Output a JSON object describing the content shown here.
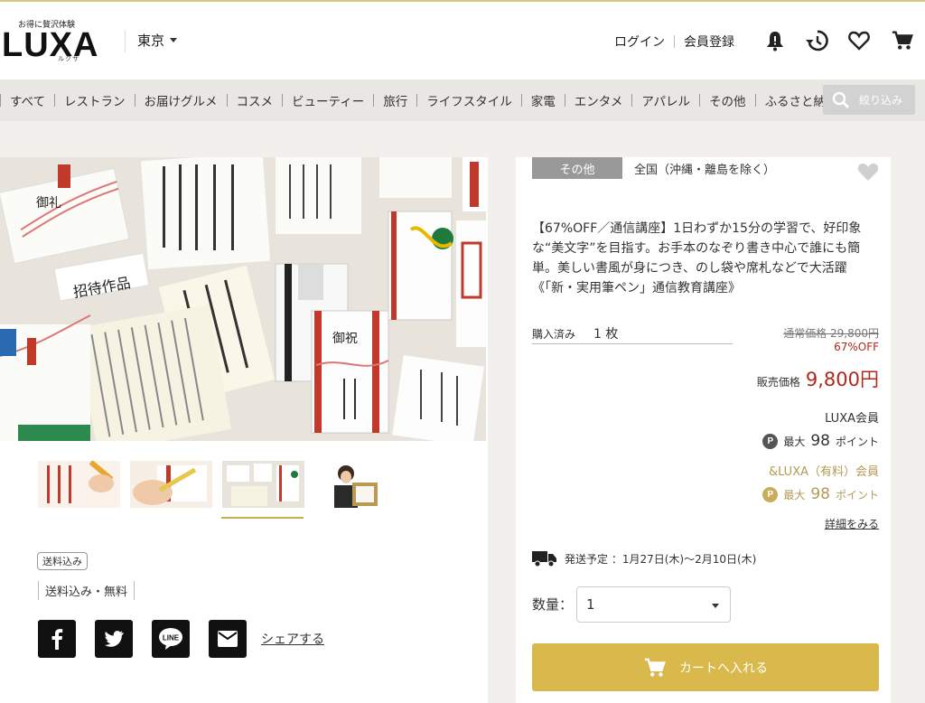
{
  "header": {
    "logo_tagline": "お得に贅沢体験",
    "logo_text": "LUXA",
    "logo_kana": "ルクサ",
    "region": "東京",
    "login": "ログイン",
    "register": "会員登録",
    "icons": [
      "bell-icon",
      "history-icon",
      "heart-icon",
      "cart-icon"
    ]
  },
  "categories": [
    "すべて",
    "レストラン",
    "お届けグルメ",
    "コスメ",
    "ビューティー",
    "旅行",
    "ライフスタイル",
    "家電",
    "エンタメ",
    "アパレル",
    "その他",
    "ふるさと納税"
  ],
  "search": {
    "label": "絞り込み"
  },
  "left": {
    "shipping_badge": "送料込み",
    "shipping_text": "送料込み・無料",
    "share": "シェアする",
    "social_icons": [
      "facebook-icon",
      "twitter-icon",
      "line-icon",
      "mail-icon"
    ],
    "image_texts": {
      "invite": "招待作品",
      "gyoshu": "御祝",
      "gorei": "御礼"
    }
  },
  "product": {
    "category": "その他",
    "area": "全国（沖縄・離島を除く）",
    "description": "【67%OFF／通信講座】1日わずか15分の学習で、好印象な“美文字”を目指す。お手本のなぞり書き中心で誰にも簡単。美しい書風が身につき、のし袋や席札などで大活躍《「新・実用筆ペン」通信教育講座》",
    "purchased_label": "購入済み",
    "purchased_value": "1 枚",
    "regular_price": "通常価格 29,800円",
    "discount": "67%OFF",
    "sale_label": "販売価格",
    "sale_price": "9,800円",
    "member_label": "LUXA会員",
    "member_points_prefix": "最大",
    "member_points": "98",
    "member_points_suffix": "ポイント",
    "premium_label": "&LUXA（有料）会員",
    "premium_points_prefix": "最大",
    "premium_points": "98",
    "premium_points_suffix": "ポイント",
    "details_link": "詳細をみる",
    "delivery": "発送予定 ：1月27日(木)〜2月10日(木)",
    "quantity_label": "数量：",
    "quantity_value": "1",
    "cart_button": "カートへ入れる"
  },
  "colors": {
    "accent_gold": "#d9b84c",
    "sale_red": "#b3261e",
    "premium_gold": "#b39a55"
  }
}
